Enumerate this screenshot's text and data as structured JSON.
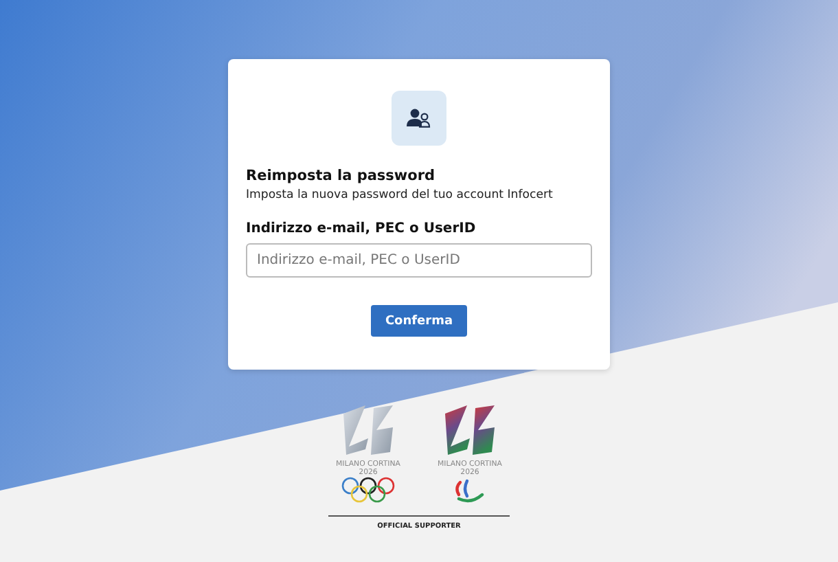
{
  "card": {
    "title": "Reimposta la password",
    "subtitle": "Imposta la nuova password del tuo account Infocert",
    "field_label": "Indirizzo e-mail, PEC o UserID",
    "field": {
      "placeholder": "Indirizzo e-mail, PEC o UserID"
    },
    "button": "Conferma"
  },
  "sponsor": {
    "logos": [
      {
        "kind": "olympic",
        "name": "MILANO CORTINA",
        "year": "2026"
      },
      {
        "kind": "paralympic",
        "name": "MILANO CORTINA",
        "year": "2026"
      }
    ],
    "caption": "OFFICIAL SUPPORTER"
  }
}
